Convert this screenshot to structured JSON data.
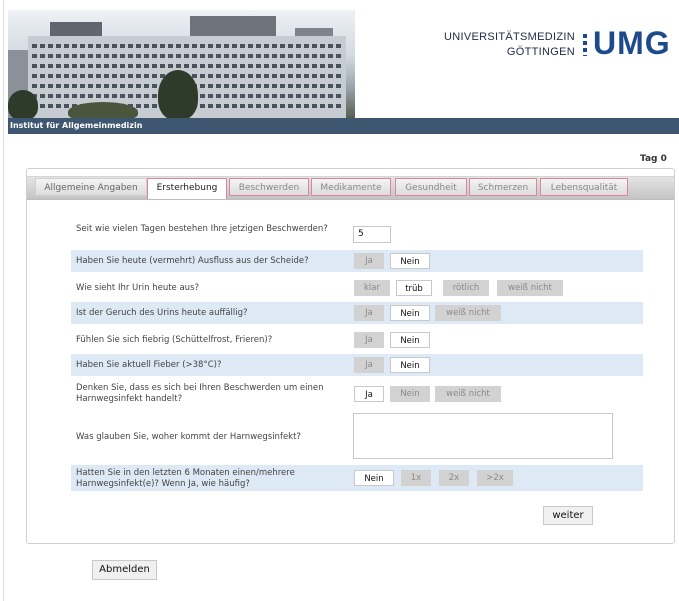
{
  "header": {
    "logo_line1": "UNIVERSITÄTSMEDIZIN",
    "logo_line2": "GÖTTINGEN",
    "logo_short": "UMG",
    "institute": "Institut für Allgemeinmedizin"
  },
  "day_label": "Tag 0",
  "tabs": [
    {
      "label": "Allgemeine Angaben"
    },
    {
      "label": "Ersterhebung"
    },
    {
      "label": "Beschwerden"
    },
    {
      "label": "Medikamente"
    },
    {
      "label": "Gesundheit"
    },
    {
      "label": "Schmerzen"
    },
    {
      "label": "Lebensqualität"
    }
  ],
  "active_tab": "Ersterhebung",
  "questions": {
    "q1": {
      "text": "Seit wie vielen Tagen bestehen Ihre jetzigen Beschwerden?",
      "value": "5"
    },
    "q2": {
      "text": "Haben Sie heute (vermehrt) Ausfluss aus der Scheide?",
      "options": [
        "Ja",
        "Nein"
      ],
      "selected": "Nein"
    },
    "q3": {
      "text": "Wie sieht Ihr Urin heute aus?",
      "options": [
        "klar",
        "trüb",
        "rötlich",
        "weiß nicht"
      ],
      "selected": "trüb"
    },
    "q4": {
      "text": "Ist der Geruch des Urins heute auffällig?",
      "options": [
        "Ja",
        "Nein",
        "weiß nicht"
      ],
      "selected": "Nein"
    },
    "q5": {
      "text": "Fühlen Sie sich fiebrig (Schüttelfrost, Frieren)?",
      "options": [
        "Ja",
        "Nein"
      ],
      "selected": "Nein"
    },
    "q6": {
      "text": "Haben Sie aktuell Fieber (>38°C)?",
      "options": [
        "Ja",
        "Nein"
      ],
      "selected": "Nein"
    },
    "q7": {
      "text": "Denken Sie, dass es sich bei Ihren Beschwerden um einen Harnwegsinfekt handelt?",
      "options": [
        "Ja",
        "Nein",
        "weiß nicht"
      ],
      "selected": "Ja"
    },
    "q8": {
      "text": "Was glauben Sie, woher kommt der Harnwegsinfekt?",
      "value": ""
    },
    "q9": {
      "text": "Hatten Sie in den letzten 6 Monaten einen/mehrere Harnwegsinfekt(e)? Wenn Ja, wie häufig?",
      "options": [
        "Nein",
        "1x",
        "2x",
        ">2x"
      ],
      "selected": "Nein"
    }
  },
  "buttons": {
    "next": "weiter",
    "logout": "Abmelden"
  },
  "colors": {
    "accent_blue": "#1c4a8c",
    "bar": "#3f5670",
    "row_highlight": "#dde9f5",
    "tab_border": "#d9889a"
  }
}
